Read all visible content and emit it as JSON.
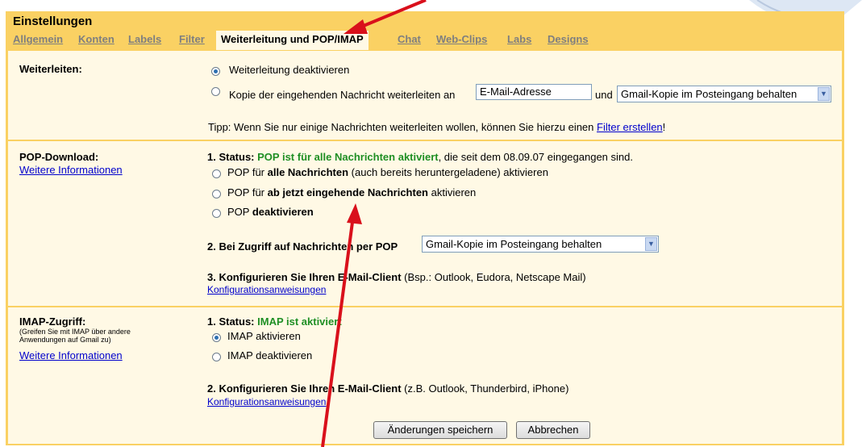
{
  "header": {
    "title": "Einstellungen",
    "tabs": [
      {
        "label": "Allgemein",
        "active": false
      },
      {
        "label": "Konten",
        "active": false
      },
      {
        "label": "Labels",
        "active": false
      },
      {
        "label": "Filter",
        "active": false
      },
      {
        "label": "Weiterleitung und POP/IMAP",
        "active": true
      },
      {
        "label": "Chat",
        "active": false
      },
      {
        "label": "Web-Clips",
        "active": false
      },
      {
        "label": "Labs",
        "active": false
      },
      {
        "label": "Designs",
        "active": false
      }
    ]
  },
  "forwarding": {
    "label": "Weiterleiten:",
    "opt_disable": "Weiterleitung deaktivieren",
    "opt_copy": "Kopie der eingehenden Nachricht weiterleiten an",
    "email_placeholder": "E-Mail-Adresse",
    "and_text": "und",
    "keep_select": "Gmail-Kopie im Posteingang behalten",
    "tip_prefix": "Tipp: Wenn Sie nur einige Nachrichten weiterleiten wollen, können Sie hierzu einen ",
    "tip_link": "Filter erstellen",
    "tip_suffix": "!"
  },
  "pop": {
    "label": "POP-Download:",
    "more_info": "Weitere Informationen",
    "status_prefix": "1. Status: ",
    "status_value": "POP ist für alle Nachrichten aktiviert",
    "status_suffix": ", die seit dem 08.09.07 eingegangen sind.",
    "opt1_a": "POP für ",
    "opt1_b": "alle Nachrichten",
    "opt1_c": " (auch bereits heruntergeladene) aktivieren",
    "opt2_a": "POP für ",
    "opt2_b": "ab jetzt eingehende Nachrichten",
    "opt2_c": " aktivieren",
    "opt3_a": "POP ",
    "opt3_b": "deaktivieren",
    "access_label": "2. Bei Zugriff auf Nachrichten per POP",
    "access_select": "Gmail-Kopie im Posteingang behalten",
    "config_bold": "3. Konfigurieren Sie Ihren E-Mail-Client",
    "config_rest": " (Bsp.: Outlook, Eudora, Netscape Mail)",
    "config_link": "Konfigurationsanweisungen"
  },
  "imap": {
    "label": "IMAP-Zugriff:",
    "sub1": "(Greifen Sie mit IMAP über andere",
    "sub2": "Anwendungen auf Gmail zu)",
    "more_info": "Weitere Informationen",
    "status_prefix": "1. Status: ",
    "status_value": "IMAP ist aktiviert",
    "opt_enable": "IMAP aktivieren",
    "opt_disable": "IMAP deaktivieren",
    "config_bold": "2. Konfigurieren Sie Ihren E-Mail-Client",
    "config_rest": " (z.B. Outlook, Thunderbird, iPhone)",
    "config_link": "Konfigurationsanweisungen"
  },
  "actions": {
    "save": "Änderungen speichern",
    "cancel": "Abbrechen"
  },
  "colors": {
    "frame": "#fad163",
    "panel": "#fff9e5",
    "status_green": "#1f8f24",
    "annotation_arrow": "#d9101b"
  }
}
